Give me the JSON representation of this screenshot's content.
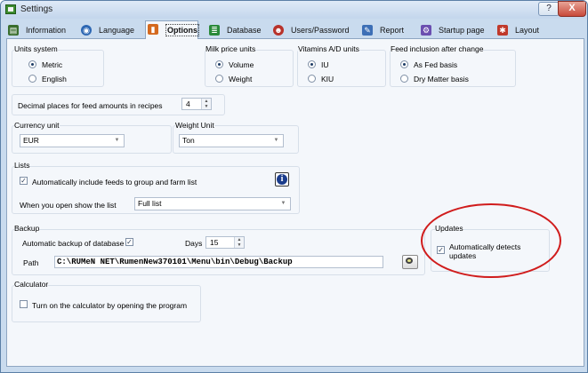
{
  "window": {
    "title": "Settings",
    "help": "?",
    "close": "X"
  },
  "tabs": [
    {
      "label": "Information",
      "icon": "info-page-icon",
      "color": "#3a6e2e"
    },
    {
      "label": "Language",
      "icon": "globe-icon",
      "color": "#2d67b3"
    },
    {
      "label": "Options",
      "icon": "options-icon",
      "color": "#d4691e"
    },
    {
      "label": "Database",
      "icon": "database-icon",
      "color": "#2a8a3a"
    },
    {
      "label": "Users/Password",
      "icon": "users-icon",
      "color": "#b8322a"
    },
    {
      "label": "Report",
      "icon": "report-icon",
      "color": "#3d6fb6"
    },
    {
      "label": "Startup page",
      "icon": "startup-icon",
      "color": "#6b4fb0"
    },
    {
      "label": "Layout",
      "icon": "layout-icon",
      "color": "#c0392b"
    }
  ],
  "units_system": {
    "label": "Units system",
    "metric": "Metric",
    "english": "English",
    "selected": "Metric"
  },
  "milk_price_units": {
    "label": "Milk price units",
    "volume": "Volume",
    "weight": "Weight",
    "selected": "Volume"
  },
  "vitamins_units": {
    "label": "Vitamins A/D units",
    "iu": "IU",
    "kiu": "KIU",
    "selected": "IU"
  },
  "feed_inclusion": {
    "label": "Feed inclusion after change",
    "as_fed": "As Fed basis",
    "dry_matter": "Dry Matter basis",
    "selected": "As Fed basis"
  },
  "decimal_places": {
    "label": "Decimal places for feed amounts in recipes",
    "value": "4"
  },
  "currency": {
    "label": "Currency unit",
    "value": "EUR"
  },
  "weight_unit": {
    "label": "Weight Unit",
    "value": "Ton"
  },
  "lists": {
    "label": "Lists",
    "auto_include": "Automatically include feeds to group and farm list",
    "auto_include_checked": true,
    "open_show_label": "When you open show the list",
    "open_show_value": "Full list"
  },
  "backup": {
    "label": "Backup",
    "auto_backup": "Automatic backup of database",
    "auto_backup_checked": true,
    "days_label": "Days",
    "days_value": "15",
    "path_label": "Path",
    "path_value": "C:\\RUMeN NET\\RumenNew370101\\Menu\\bin\\Debug\\Backup"
  },
  "updates": {
    "label": "Updates",
    "auto_detect": "Automatically detects updates",
    "checked": true
  },
  "calculator": {
    "label": "Calculator",
    "turn_on": "Turn on the calculator by opening the program",
    "checked": false
  },
  "annotation_color": "#d01c1c"
}
